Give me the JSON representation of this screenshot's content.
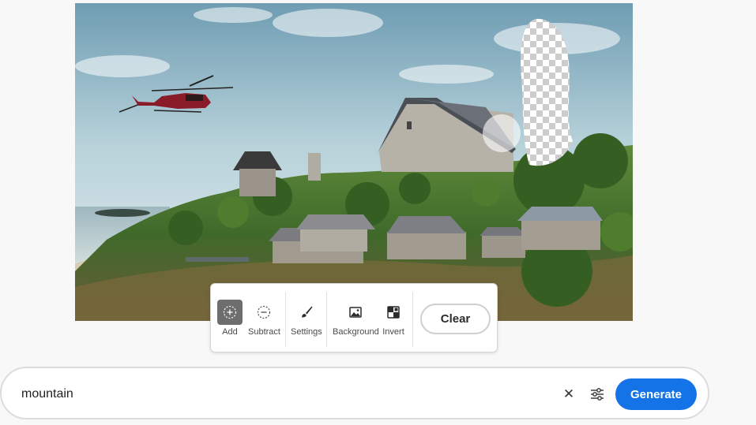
{
  "canvas": {
    "image_name": "farm-hillside-scene"
  },
  "toolbar": {
    "tools": [
      {
        "label": "Add",
        "icon": "add-selection-icon",
        "active": true
      },
      {
        "label": "Subtract",
        "icon": "subtract-selection-icon",
        "active": false
      },
      {
        "label": "Settings",
        "icon": "brush-icon",
        "active": false
      },
      {
        "label": "Background",
        "icon": "image-icon",
        "active": false
      },
      {
        "label": "Invert",
        "icon": "invert-icon",
        "active": false
      }
    ],
    "clear_label": "Clear"
  },
  "prompt": {
    "value": "mountain",
    "clear_icon": "close-icon",
    "settings_icon": "sliders-icon",
    "generate_label": "Generate"
  },
  "colors": {
    "accent": "#1473e6",
    "active_tool": "#6e6e6e"
  }
}
